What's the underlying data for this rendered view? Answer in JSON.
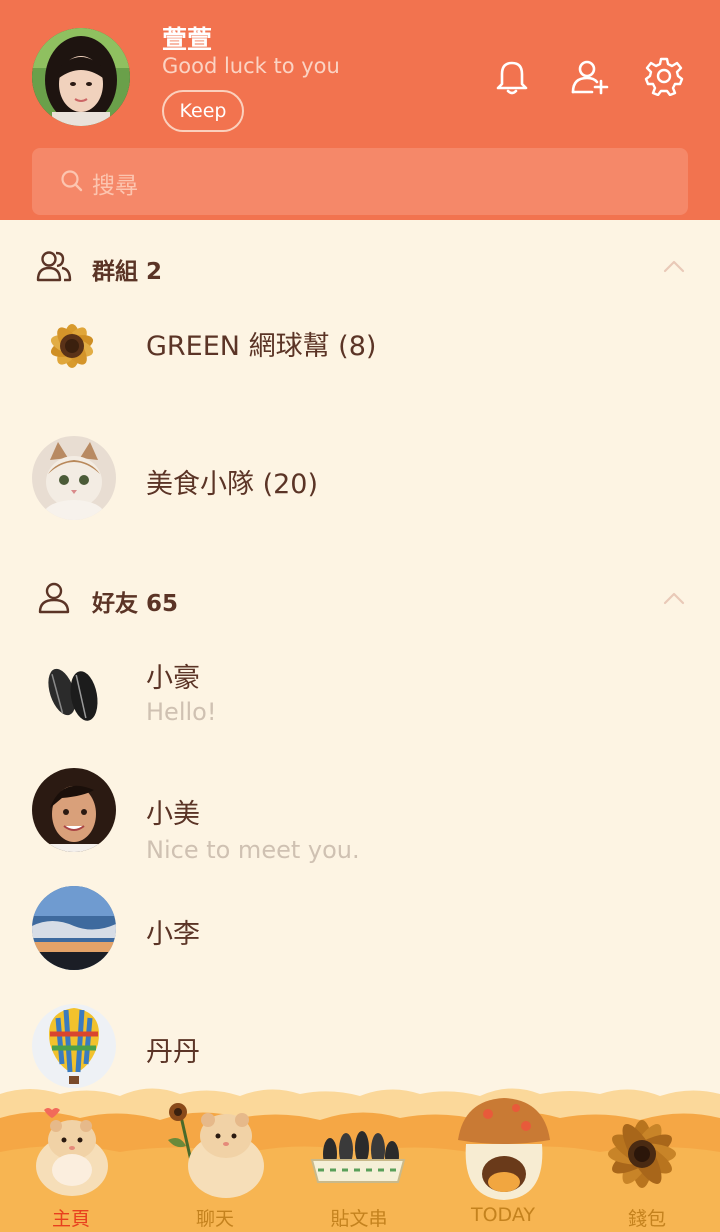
{
  "profile": {
    "name": "萱萱",
    "status": "Good luck to you",
    "keep_label": "Keep"
  },
  "search": {
    "placeholder": "搜尋"
  },
  "groups": {
    "title": "群組 2",
    "items": [
      {
        "name": "GREEN 網球幫 (8)",
        "avatar": "sunflower"
      },
      {
        "name": "美食小隊 (20)",
        "avatar": "cat"
      }
    ]
  },
  "friends": {
    "title": "好友 65",
    "items": [
      {
        "name": "小豪",
        "status": "Hello!",
        "avatar": "seeds"
      },
      {
        "name": "小美",
        "status": "Nice to meet you.",
        "avatar": "woman"
      },
      {
        "name": "小李",
        "status": "",
        "avatar": "sky"
      },
      {
        "name": "丹丹",
        "status": "",
        "avatar": "balloon"
      }
    ]
  },
  "nav": {
    "items": [
      {
        "label": "主頁",
        "active": true
      },
      {
        "label": "聊天",
        "active": false
      },
      {
        "label": "貼文串",
        "active": false
      },
      {
        "label": "TODAY",
        "active": false
      },
      {
        "label": "錢包",
        "active": false
      }
    ]
  },
  "colors": {
    "header": "#f2734f",
    "background": "#fdf4e3",
    "text_primary": "#5b3426",
    "nav_active": "#e8401e",
    "nav_inactive": "#c4821e"
  }
}
